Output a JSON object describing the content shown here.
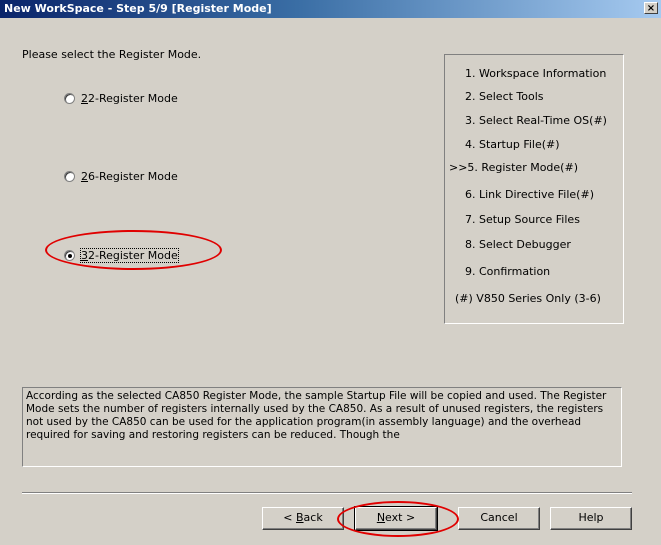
{
  "window": {
    "title": "New WorkSpace - Step 5/9 [Register Mode]",
    "close_label": "×"
  },
  "prompt": "Please select the Register Mode.",
  "register_modes": [
    {
      "mnemonic": "2",
      "rest": "2-Register Mode",
      "label": "22-Register Mode",
      "checked": false
    },
    {
      "mnemonic": "2",
      "rest": "6-Register Mode",
      "label": "26-Register Mode",
      "checked": false
    },
    {
      "mnemonic": "3",
      "rest": "2-Register Mode",
      "label": "32-Register Mode",
      "checked": true
    }
  ],
  "steps": [
    "1. Workspace Information",
    "2. Select Tools",
    "3. Select Real-Time OS(#)",
    "4. Startup File(#)",
    ">>5. Register Mode(#)",
    "6. Link Directive File(#)",
    "7. Setup Source Files",
    "8. Select Debugger",
    "9. Confirmation",
    "(#) V850 Series Only (3-6)"
  ],
  "description": "According as the selected CA850 Register Mode, the sample Startup File will be copied and used. The Register Mode sets the number of registers internally used by the CA850. As a result of unused registers, the registers not used by the CA850 can be used for the application program(in assembly language) and the overhead required for saving and restoring registers can be reduced. Though the",
  "buttons": {
    "back": {
      "prefix": "< ",
      "mnemonic": "B",
      "rest": "ack"
    },
    "next": {
      "mnemonic": "N",
      "rest": "ext >"
    },
    "cancel": "Cancel",
    "help": "Help"
  },
  "colors": {
    "title_bar_start": "#0a246a",
    "title_bar_end": "#a6caf0",
    "dialog_face": "#d4d0c8",
    "annotation_red": "#e00000"
  }
}
